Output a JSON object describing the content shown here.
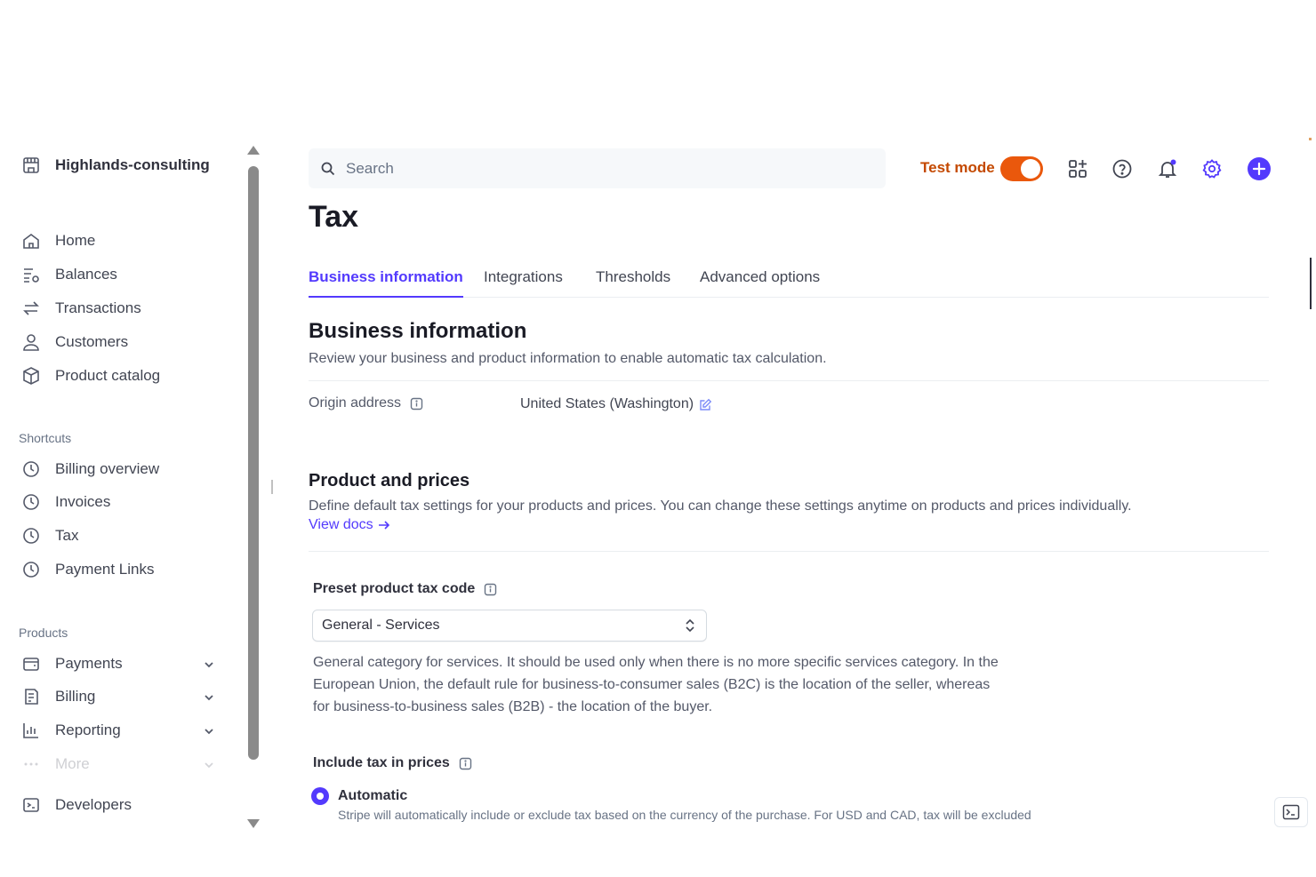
{
  "sidebar": {
    "account_name": "Highlands-consulting",
    "nav": [
      {
        "label": "Home",
        "icon": "home-icon"
      },
      {
        "label": "Balances",
        "icon": "balances-icon"
      },
      {
        "label": "Transactions",
        "icon": "transactions-icon"
      },
      {
        "label": "Customers",
        "icon": "customers-icon"
      },
      {
        "label": "Product catalog",
        "icon": "product-catalog-icon"
      }
    ],
    "shortcuts_label": "Shortcuts",
    "shortcuts": [
      {
        "label": "Billing overview",
        "icon": "clock-icon"
      },
      {
        "label": "Invoices",
        "icon": "clock-icon"
      },
      {
        "label": "Tax",
        "icon": "clock-icon"
      },
      {
        "label": "Payment Links",
        "icon": "clock-icon"
      }
    ],
    "products_label": "Products",
    "products": [
      {
        "label": "Payments",
        "icon": "payments-icon"
      },
      {
        "label": "Billing",
        "icon": "billing-icon"
      },
      {
        "label": "Reporting",
        "icon": "reporting-icon"
      },
      {
        "label": "More",
        "icon": "more-icon"
      }
    ],
    "developers_label": "Developers"
  },
  "header": {
    "search_placeholder": "Search",
    "test_mode_label": "Test mode",
    "test_mode_on": true,
    "accent_color": "#533afd",
    "test_mode_color": "#ea580c"
  },
  "page": {
    "title": "Tax",
    "tabs": [
      "Business information",
      "Integrations",
      "Thresholds",
      "Advanced options"
    ],
    "active_tab": "Business information"
  },
  "business_info": {
    "heading": "Business information",
    "description": "Review your business and product information to enable automatic tax calculation.",
    "origin_label": "Origin address",
    "origin_value": "United States (Washington)"
  },
  "products_prices": {
    "heading": "Product and prices",
    "description": "Define default tax settings for your products and prices. You can change these settings anytime on products and prices individually.",
    "view_docs": "View docs",
    "preset_label": "Preset product tax code",
    "preset_value": "General - Services",
    "preset_help_1": "General category for services. It should be used only when there is no more specific services category. In the",
    "preset_help_2": "European Union, the default rule for business-to-consumer sales (B2C) is the location of the seller, whereas",
    "preset_help_3": "for business-to-business sales (B2B) - the location of the buyer.",
    "include_tax_label": "Include tax in prices",
    "automatic_label": "Automatic",
    "automatic_desc": "Stripe will automatically include or exclude tax based on the currency of the purchase. For USD and CAD, tax will be excluded"
  }
}
